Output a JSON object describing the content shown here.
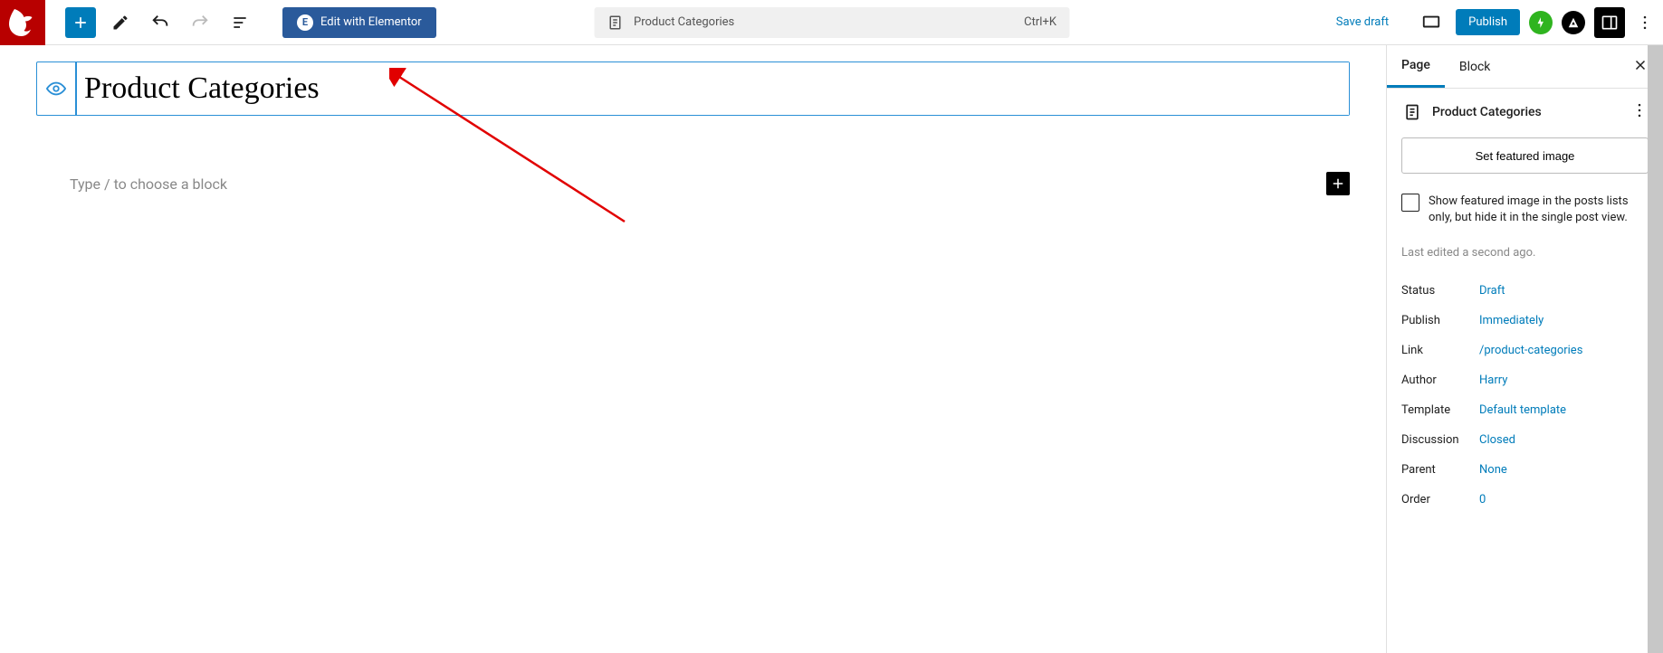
{
  "topbar": {
    "elementor_label": "Edit with Elementor",
    "center_title": "Product Categories",
    "shortcut": "Ctrl+K",
    "save_draft": "Save draft",
    "publish": "Publish"
  },
  "editor": {
    "title_value": "Product Categories",
    "block_placeholder": "Type / to choose a block"
  },
  "sidebar": {
    "tabs": {
      "page": "Page",
      "block": "Block"
    },
    "title": "Product Categories",
    "featured_button": "Set featured image",
    "checkbox_label": "Show featured image in the posts lists only, but hide it in the single post view.",
    "last_edited": "Last edited a second ago.",
    "meta": {
      "status_label": "Status",
      "status_value": "Draft",
      "publish_label": "Publish",
      "publish_value": "Immediately",
      "link_label": "Link",
      "link_value": "/product-categories",
      "author_label": "Author",
      "author_value": "Harry",
      "template_label": "Template",
      "template_value": "Default template",
      "discussion_label": "Discussion",
      "discussion_value": "Closed",
      "parent_label": "Parent",
      "parent_value": "None",
      "order_label": "Order",
      "order_value": "0"
    }
  }
}
